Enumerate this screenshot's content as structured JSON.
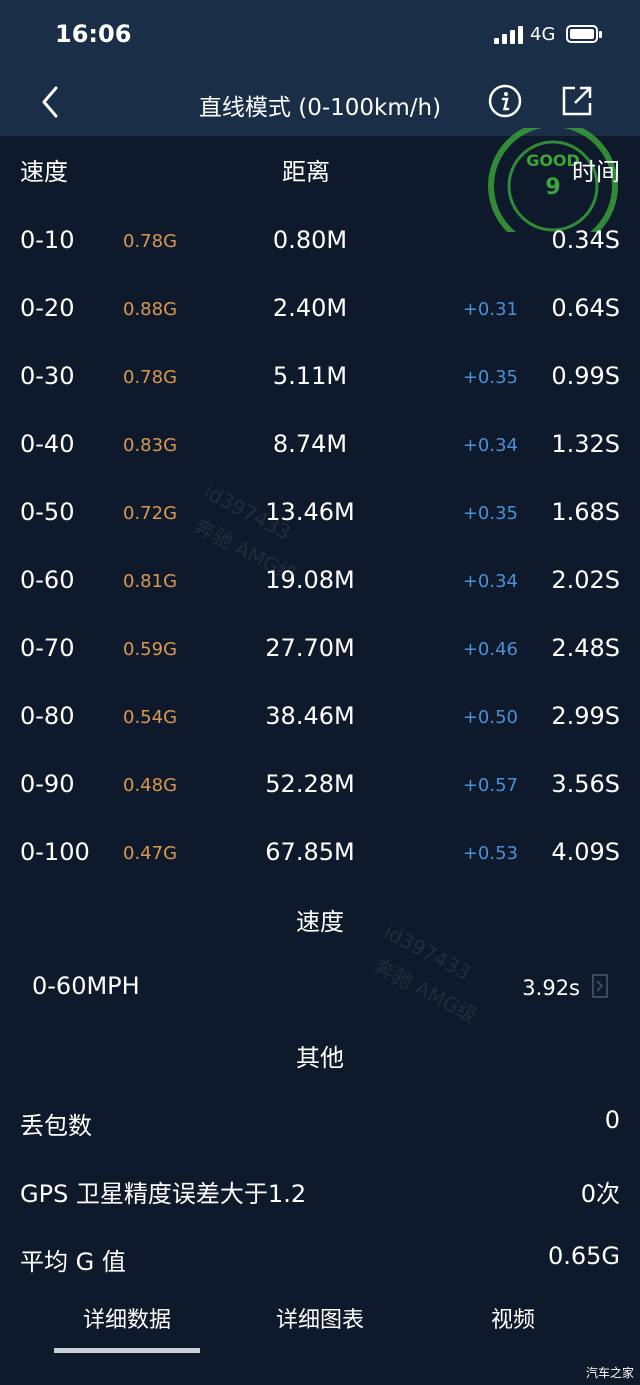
{
  "status_bar": {
    "time": "16:06",
    "network": "4G"
  },
  "nav": {
    "title": "直线模式 (0-100km/h)",
    "back_icon": "chevron-left-icon",
    "info_icon": "info-icon",
    "share_icon": "share-icon"
  },
  "columns": {
    "speed": "速度",
    "distance": "距离",
    "time": "时间"
  },
  "rows": [
    {
      "speed": "0-10",
      "g": "0.78G",
      "distance": "0.80M",
      "delta": "",
      "time": "0.34S"
    },
    {
      "speed": "0-20",
      "g": "0.88G",
      "distance": "2.40M",
      "delta": "+0.31",
      "time": "0.64S"
    },
    {
      "speed": "0-30",
      "g": "0.78G",
      "distance": "5.11M",
      "delta": "+0.35",
      "time": "0.99S"
    },
    {
      "speed": "0-40",
      "g": "0.83G",
      "distance": "8.74M",
      "delta": "+0.34",
      "time": "1.32S"
    },
    {
      "speed": "0-50",
      "g": "0.72G",
      "distance": "13.46M",
      "delta": "+0.35",
      "time": "1.68S"
    },
    {
      "speed": "0-60",
      "g": "0.81G",
      "distance": "19.08M",
      "delta": "+0.34",
      "time": "2.02S"
    },
    {
      "speed": "0-70",
      "g": "0.59G",
      "distance": "27.70M",
      "delta": "+0.46",
      "time": "2.48S"
    },
    {
      "speed": "0-80",
      "g": "0.54G",
      "distance": "38.46M",
      "delta": "+0.50",
      "time": "2.99S"
    },
    {
      "speed": "0-90",
      "g": "0.48G",
      "distance": "52.28M",
      "delta": "+0.57",
      "time": "3.56S"
    },
    {
      "speed": "0-100",
      "g": "0.47G",
      "distance": "67.85M",
      "delta": "+0.53",
      "time": "4.09S"
    }
  ],
  "speed_section": {
    "title": "速度",
    "mph_label": "0-60MPH",
    "mph_value": "3.92s"
  },
  "other_section": {
    "title": "其他",
    "items": [
      {
        "label": "丢包数",
        "value": "0"
      },
      {
        "label": "GPS 卫星精度误差大于1.2",
        "value": "0次"
      },
      {
        "label": "平均 G 值",
        "value": "0.65G"
      }
    ]
  },
  "tabs": [
    {
      "label": "详细数据",
      "active": true
    },
    {
      "label": "详细图表",
      "active": false
    },
    {
      "label": "视频",
      "active": false
    }
  ],
  "stamp": {
    "top_text": "GOOD",
    "number": "9"
  },
  "watermark": {
    "user": "id397433",
    "club": "奔驰 AMG级"
  },
  "corner_mark": "汽车之家",
  "colors": {
    "background": "#0e1a2b",
    "header": "#1a2e47",
    "g_value": "#d99850",
    "delta": "#4a8fd6",
    "stamp": "#3aa63a"
  }
}
